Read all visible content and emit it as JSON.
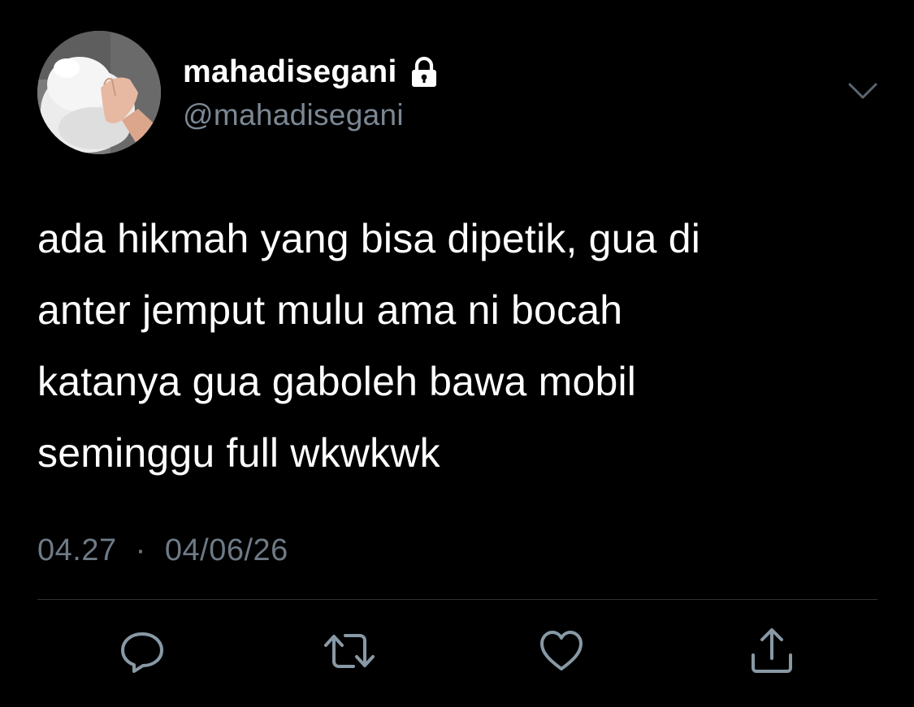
{
  "user": {
    "display_name": "mahadisegani",
    "handle": "@mahadisegani",
    "protected_icon": "lock-icon",
    "avatar": "white-dog-being-petted-photo"
  },
  "tweet": {
    "lines": [
      "ada hikmah yang bisa dipetik, gua di",
      "anter jemput mulu ama ni bocah",
      "katanya gua gaboleh bawa mobil",
      "seminggu full wkwkwk"
    ],
    "time": "04.27",
    "separator": "·",
    "date": "04/06/26"
  },
  "actions": [
    {
      "icon": "reply-icon"
    },
    {
      "icon": "retweet-icon"
    },
    {
      "icon": "like-icon"
    },
    {
      "icon": "share-icon"
    }
  ],
  "colors": {
    "background": "#000000",
    "text": "#ffffff",
    "secondary_text": "#7b8894",
    "icon": "#8899a6",
    "divider": "#2f3336"
  }
}
